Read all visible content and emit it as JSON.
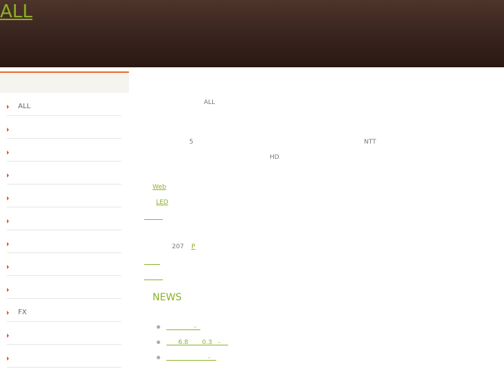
{
  "header": {
    "site_title": "ALL"
  },
  "sidebar": {
    "items": [
      {
        "label": "ALL"
      },
      {
        "label": ""
      },
      {
        "label": ""
      },
      {
        "label": ""
      },
      {
        "label": ""
      },
      {
        "label": ""
      },
      {
        "label": ""
      },
      {
        "label": ""
      },
      {
        "label": ""
      },
      {
        "label": "FX"
      },
      {
        "label": ""
      },
      {
        "label": ""
      }
    ]
  },
  "main": {
    "intro_all": "ALL",
    "line2_num": "5",
    "line2_ntt": "NTT",
    "line3_hd": "HD",
    "link_web": "Web",
    "link_led": "LED",
    "count": "207",
    "link_p": "P",
    "news_heading": "NEWS",
    "news_items": [
      {
        "text": "              -  "
      },
      {
        "text": "      6.8       0.3   -    "
      },
      {
        "text": "                     -   "
      }
    ]
  }
}
